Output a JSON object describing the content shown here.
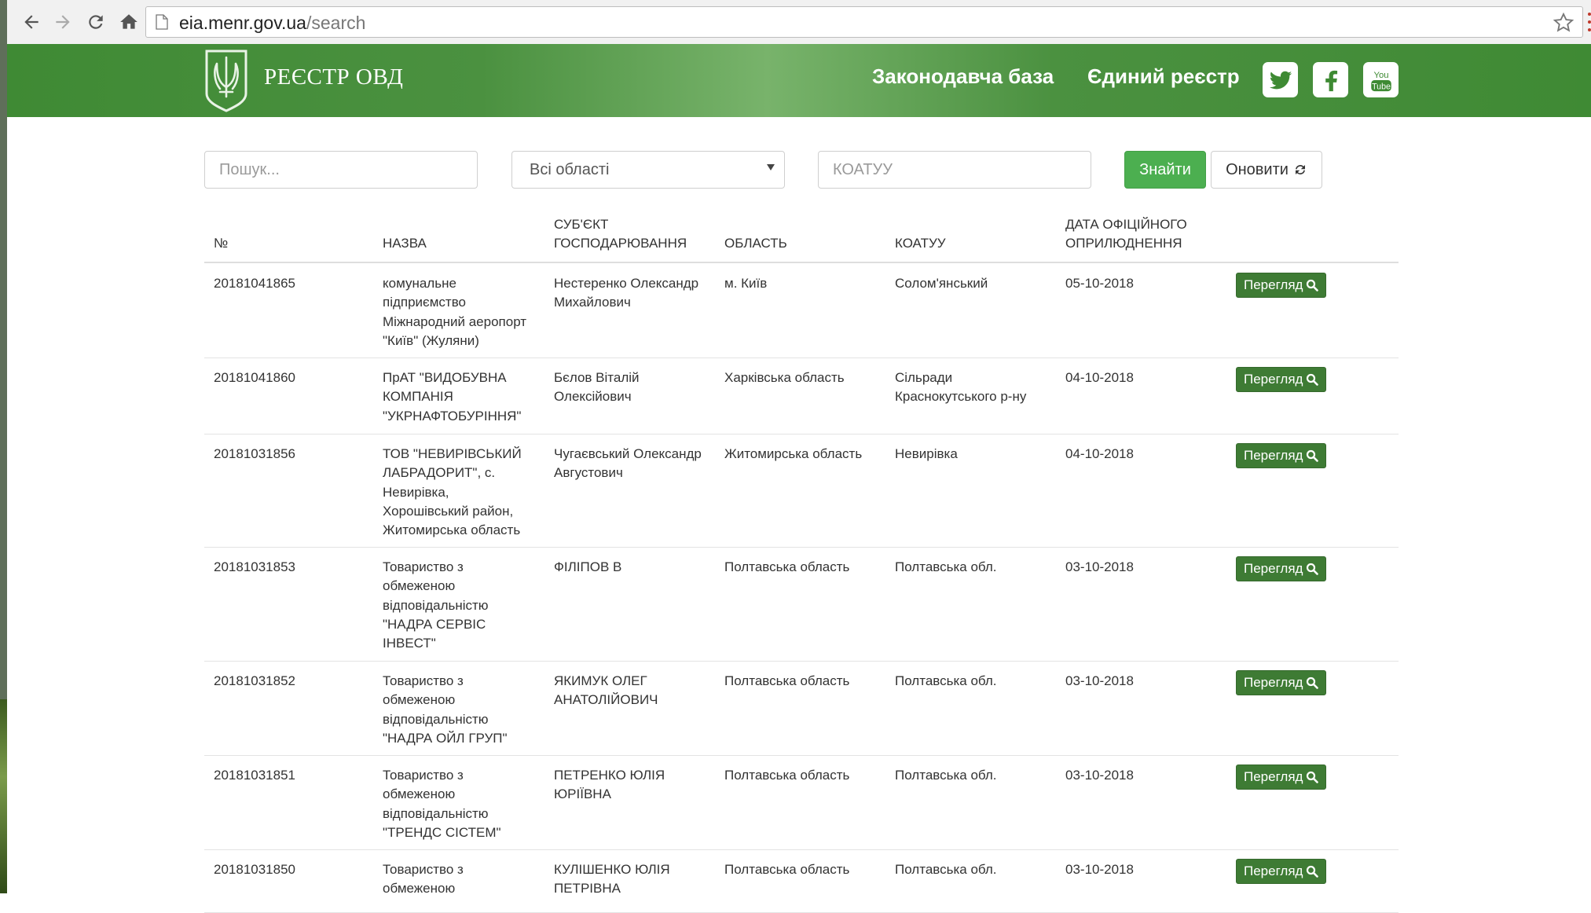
{
  "browser": {
    "url_host": "eia.menr.gov.ua",
    "url_path": "/search"
  },
  "header": {
    "brand": "РЕЄСТР ОВД",
    "nav": [
      "Законодавча база",
      "Єдиний реєстр"
    ],
    "social": [
      "twitter-icon",
      "facebook-icon",
      "youtube-icon"
    ]
  },
  "search": {
    "query_placeholder": "Пошук...",
    "region_selected": "Всі області",
    "koatuu_placeholder": "КОАТУУ",
    "find_label": "Знайти",
    "refresh_label": "Оновити"
  },
  "table": {
    "headers": {
      "num": "№",
      "name": "НАЗВА",
      "subject_line1": "СУБ'ЄКТ",
      "subject_line2": "ГОСПОДАРЮВАННЯ",
      "region": "ОБЛАСТЬ",
      "koatuu": "КОАТУУ",
      "date_line1": "ДАТА ОФІЦІЙНОГО",
      "date_line2": "ОПРИЛЮДНЕННЯ"
    },
    "view_label": "Перегляд",
    "rows": [
      {
        "num": "20181041865",
        "name": [
          "комунальне",
          "підприємство",
          "Міжнародний аеропорт",
          "\"Київ\" (Жуляни)"
        ],
        "subject": [
          "Нестеренко Олександр",
          "Михайлович"
        ],
        "region": [
          "м. Київ"
        ],
        "koatuu": [
          "Солом'янський"
        ],
        "date": "05-10-2018"
      },
      {
        "num": "20181041860",
        "name": [
          "ПрАТ \"ВИДОБУВНА",
          "КОМПАНІЯ",
          "\"УКРНАФТОБУРІННЯ\""
        ],
        "subject": [
          "Бєлов Віталій",
          "Олексійович"
        ],
        "region": [
          "Харківська область"
        ],
        "koatuu": [
          "Сільради",
          "Краснокутського р-ну"
        ],
        "date": "04-10-2018"
      },
      {
        "num": "20181031856",
        "name": [
          "ТОВ \"НЕВИРІВСЬКИЙ",
          "ЛАБРАДОРИТ\", с.",
          "Невирівка,",
          "Хорошівський район,",
          "Житомирська область"
        ],
        "subject": [
          "Чугаєвський Олександр",
          "Августович"
        ],
        "region": [
          "Житомирська область"
        ],
        "koatuu": [
          "Невирівка"
        ],
        "date": "04-10-2018"
      },
      {
        "num": "20181031853",
        "name": [
          "Товариство з",
          "обмеженою",
          "відповідальністю",
          "\"НАДРА СЕРВІС",
          "ІНВЕСТ\""
        ],
        "subject": [
          "ФІЛІПОВ В"
        ],
        "region": [
          "Полтавська область"
        ],
        "koatuu": [
          "Полтавська обл."
        ],
        "date": "03-10-2018"
      },
      {
        "num": "20181031852",
        "name": [
          "Товариство з",
          "обмеженою",
          "відповідальністю",
          "\"НАДРА ОЙЛ ГРУП\""
        ],
        "subject": [
          "ЯКИМУК ОЛЕГ",
          "АНАТОЛІЙОВИЧ"
        ],
        "region": [
          "Полтавська область"
        ],
        "koatuu": [
          "Полтавська обл."
        ],
        "date": "03-10-2018"
      },
      {
        "num": "20181031851",
        "name": [
          "Товариство з",
          "обмеженою",
          "відповідальністю",
          "\"ТРЕНДС СІСТЕМ\""
        ],
        "subject": [
          "ПЕТРЕНКО ЮЛІЯ",
          "ЮРІЇВНА"
        ],
        "region": [
          "Полтавська область"
        ],
        "koatuu": [
          "Полтавська обл."
        ],
        "date": "03-10-2018"
      },
      {
        "num": "20181031850",
        "name": [
          "Товариство з",
          "обмеженою"
        ],
        "subject": [
          "КУЛІШЕНКО ЮЛІЯ",
          "ПЕТРІВНА"
        ],
        "region": [
          "Полтавська область"
        ],
        "koatuu": [
          "Полтавська обл."
        ],
        "date": "03-10-2018"
      }
    ]
  }
}
